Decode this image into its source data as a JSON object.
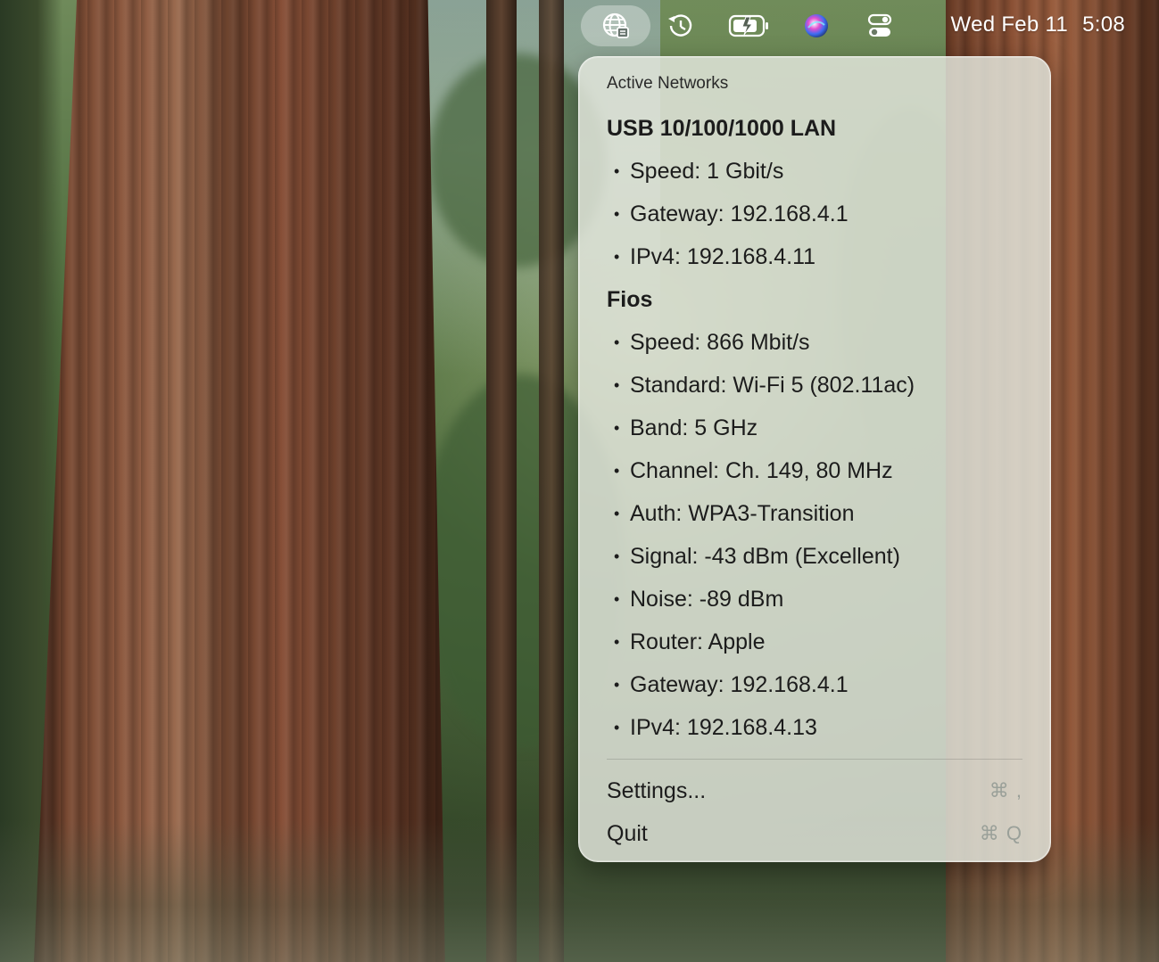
{
  "menubar": {
    "icons": [
      "network-globe-icon",
      "time-machine-icon",
      "battery-charging-icon",
      "siri-icon",
      "control-center-icon"
    ],
    "clock": {
      "date": "Wed Feb 11",
      "time": "5:08"
    }
  },
  "menu": {
    "header": "Active Networks",
    "networks": [
      {
        "name": "USB 10/100/1000 LAN",
        "details": [
          "Speed: 1 Gbit/s",
          "Gateway: 192.168.4.1",
          "IPv4: 192.168.4.11"
        ]
      },
      {
        "name": "Fios",
        "details": [
          "Speed: 866 Mbit/s",
          "Standard: Wi-Fi 5 (802.11ac)",
          "Band: 5 GHz",
          "Channel: Ch. 149, 80 MHz",
          "Auth: WPA3-Transition",
          "Signal: -43 dBm (Excellent)",
          "Noise: -89 dBm",
          "Router: Apple",
          "Gateway: 192.168.4.1",
          "IPv4: 192.168.4.13"
        ]
      }
    ],
    "bullet": "•",
    "actions": [
      {
        "label": "Settings...",
        "shortcut": "⌘ ,"
      },
      {
        "label": "Quit",
        "shortcut": "⌘ Q"
      }
    ]
  }
}
